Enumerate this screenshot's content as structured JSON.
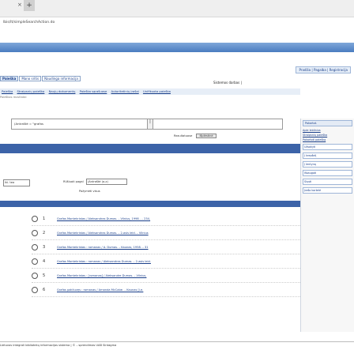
{
  "browser": {
    "tab_close": "×",
    "tab_plus": "+",
    "url": "lbis/lt/simpleSearchAction.do"
  },
  "header": {
    "top_links": "Pradžia | Pagalba | Registracija",
    "system_status": "Sistemos darbas |"
  },
  "tabs": [
    {
      "label": "Paieška"
    },
    {
      "label": "Mano sritis"
    },
    {
      "label": "Naudinga informacija"
    }
  ],
  "subnav": {
    "items": [
      "Paieška",
      "Straipsnių paieška",
      "Naujų dokumentų",
      "Paieška sąrašuose",
      "Autoritetinių įrašai",
      "Unifikuota paieška"
    ],
    "secondary": "Paieškos rezultatai"
  },
  "search": {
    "query_value": "(Antraštė = \"grafas",
    "button_label": "|",
    "option_label": "Rezultatuose",
    "option_button": "Išplėstinė"
  },
  "results": {
    "sort_label": "Rūšiuoti pagal",
    "sort_value": "(Antraštė (a-z)",
    "count_label": "Pažymėti visus",
    "page_select": "iki. tea",
    "rows": [
      {
        "num": "1",
        "title": "Grafas Montekristas / Aleksandras Dumas. – Vilnius, 1998 . – 234,"
      },
      {
        "num": "2",
        "title": "Grafas Montekristas / Aleksandras Dumas. – 2-asis leid. – Vilnius"
      },
      {
        "num": "3",
        "title": "Grafas Montekristas : romanas / A. Dumas. – Kaunas, 1958. – 31"
      },
      {
        "num": "4",
        "title": "Grafas Montekristas : romanas / Aleksandras Dumas. – 2-asis leid."
      },
      {
        "num": "5",
        "title": "Grafas Montekristas : [romanas] / Aleksandre Dumas. – Vilnius,"
      },
      {
        "num": "6",
        "title": "Grafas pakliuvęs : romanas / Amanda McCabe. – Kaunas [i.e."
      }
    ]
  },
  "sidebar": {
    "title": "Pakartot.",
    "links": [
      "Apie leidinius",
      "Straipsnių paieška",
      "Pakartoti paiešką"
    ],
    "boxes": [
      "Užsakyti",
      "Į krepšelį",
      "Į lentyną",
      "Išsaugoti",
      "Siųsti",
      "Įrašo kortelė"
    ]
  },
  "footer": {
    "text": "Lietuvos integrali bibliotekų informacijos sistema | © – sprendimas UAB Sintagma"
  }
}
